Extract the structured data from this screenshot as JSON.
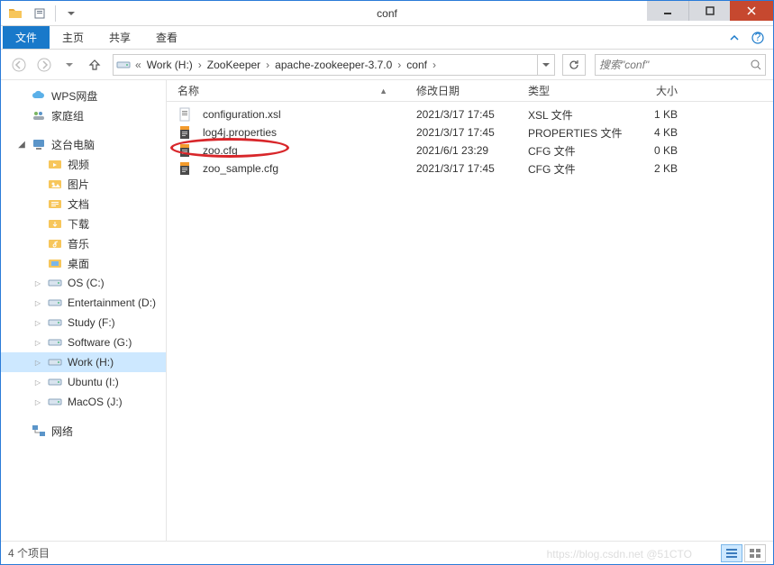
{
  "window": {
    "title": "conf"
  },
  "ribbon": {
    "file": "文件",
    "tabs": [
      "主页",
      "共享",
      "查看"
    ]
  },
  "breadcrumb": {
    "items": [
      "Work (H:)",
      "ZooKeeper",
      "apache-zookeeper-3.7.0",
      "conf"
    ]
  },
  "search": {
    "placeholder": "搜索\"conf\""
  },
  "sidebar": {
    "top_items": [
      {
        "label": "WPS网盘",
        "icon": "cloud"
      },
      {
        "label": "家庭组",
        "icon": "homegroup"
      }
    ],
    "computer_label": "这台电脑",
    "computer_items": [
      {
        "label": "视频",
        "icon": "folder-video"
      },
      {
        "label": "图片",
        "icon": "folder-pics"
      },
      {
        "label": "文档",
        "icon": "folder-docs"
      },
      {
        "label": "下载",
        "icon": "folder-down"
      },
      {
        "label": "音乐",
        "icon": "folder-music"
      },
      {
        "label": "桌面",
        "icon": "folder-desk"
      },
      {
        "label": "OS (C:)",
        "icon": "drive"
      },
      {
        "label": "Entertainment (D:)",
        "icon": "drive"
      },
      {
        "label": "Study (F:)",
        "icon": "drive"
      },
      {
        "label": "Software (G:)",
        "icon": "drive"
      },
      {
        "label": "Work (H:)",
        "icon": "drive",
        "selected": true
      },
      {
        "label": "Ubuntu (I:)",
        "icon": "drive"
      },
      {
        "label": "MacOS (J:)",
        "icon": "drive"
      }
    ],
    "network_label": "网络"
  },
  "columns": {
    "name": "名称",
    "date": "修改日期",
    "type": "类型",
    "size": "大小"
  },
  "files": [
    {
      "name": "configuration.xsl",
      "date": "2021/3/17 17:45",
      "type": "XSL 文件",
      "size": "1 KB",
      "icon": "xsl"
    },
    {
      "name": "log4j.properties",
      "date": "2021/3/17 17:45",
      "type": "PROPERTIES 文件",
      "size": "4 KB",
      "icon": "cfg"
    },
    {
      "name": "zoo.cfg",
      "date": "2021/6/1 23:29",
      "type": "CFG 文件",
      "size": "0 KB",
      "icon": "cfg",
      "highlighted": true
    },
    {
      "name": "zoo_sample.cfg",
      "date": "2021/3/17 17:45",
      "type": "CFG 文件",
      "size": "2 KB",
      "icon": "cfg"
    }
  ],
  "status": {
    "count_text": "4 个项目"
  },
  "watermark": "https://blog.csdn.net @51CTO"
}
